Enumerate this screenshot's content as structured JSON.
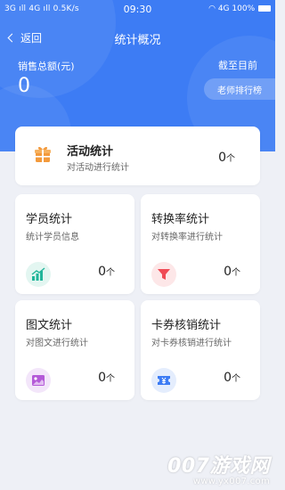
{
  "status_bar": {
    "left": "3G ıll 4G ıll 0.5K/s",
    "time": "09:30",
    "right": "4G 100%"
  },
  "nav": {
    "back_label": "返回",
    "title": "统计概况"
  },
  "summary": {
    "sales_label": "销售总额(元)",
    "sales_value": "0",
    "deadline_label": "截至目前",
    "rank_button": "老师排行榜"
  },
  "activity": {
    "title": "活动统计",
    "subtitle": "对活动进行统计",
    "count": "0",
    "unit": "个"
  },
  "cards": [
    {
      "title": "学员统计",
      "subtitle": "统计学员信息",
      "count": "0",
      "unit": "个",
      "icon": "bar-chart-icon",
      "color": "#22b59a"
    },
    {
      "title": "转换率统计",
      "subtitle": "对转换率进行统计",
      "count": "0",
      "unit": "个",
      "icon": "funnel-icon",
      "color": "#f04a55"
    },
    {
      "title": "图文统计",
      "subtitle": "对图文进行统计",
      "count": "0",
      "unit": "个",
      "icon": "image-icon",
      "color": "#b45ad8"
    },
    {
      "title": "卡券核销统计",
      "subtitle": "对卡券核销进行统计",
      "count": "0",
      "unit": "个",
      "icon": "ticket-icon",
      "color": "#3d7cf4"
    }
  ],
  "watermark": {
    "main": "007游戏网",
    "sub": "www.yx007.com"
  },
  "colors": {
    "primary": "#3d7cf4",
    "background": "#eef0f6",
    "gift": "#f39a3c"
  }
}
